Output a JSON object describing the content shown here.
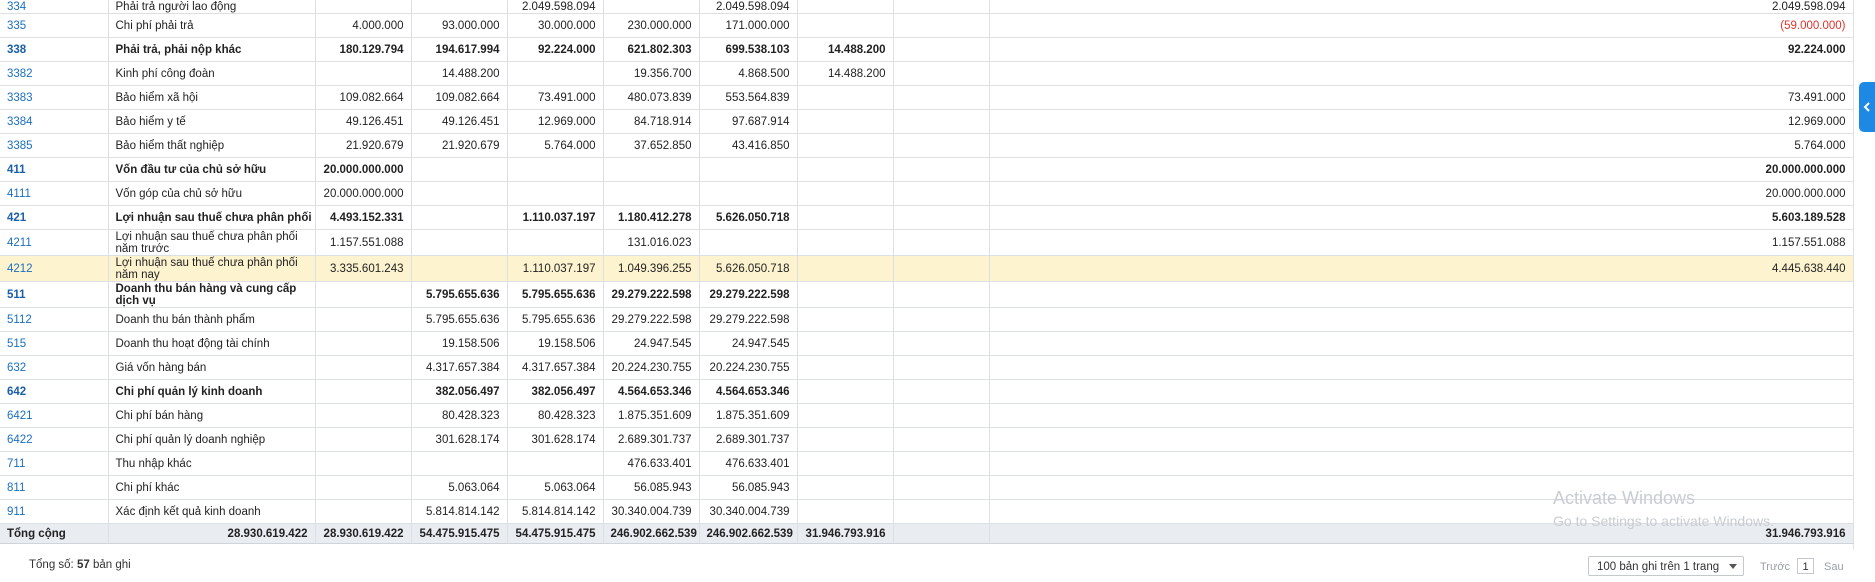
{
  "table": {
    "rows": [
      {
        "acct": "334",
        "name": "Phải trả người lao động",
        "c1": "",
        "c2": "",
        "c3": "2.049.598.094",
        "c4": "",
        "c5": "2.049.598.094",
        "c6": "",
        "c7": "",
        "c8": "2.049.598.094",
        "bold": false
      },
      {
        "acct": "335",
        "name": "Chi phí phải trả",
        "c1": "4.000.000",
        "c2": "93.000.000",
        "c3": "30.000.000",
        "c4": "230.000.000",
        "c5": "171.000.000",
        "c6": "",
        "c7": "",
        "c8": "(59.000.000)",
        "bold": false,
        "neg": true
      },
      {
        "acct": "338",
        "name": "Phải trả, phải nộp khác",
        "c1": "180.129.794",
        "c2": "194.617.994",
        "c3": "92.224.000",
        "c4": "621.802.303",
        "c5": "699.538.103",
        "c6": "14.488.200",
        "c7": "",
        "c8": "92.224.000",
        "bold": true
      },
      {
        "acct": "3382",
        "name": "Kinh phí công đoàn",
        "c1": "",
        "c2": "14.488.200",
        "c3": "",
        "c4": "19.356.700",
        "c5": "4.868.500",
        "c6": "14.488.200",
        "c7": "",
        "c8": "",
        "bold": false
      },
      {
        "acct": "3383",
        "name": "Bảo hiểm xã hội",
        "c1": "109.082.664",
        "c2": "109.082.664",
        "c3": "73.491.000",
        "c4": "480.073.839",
        "c5": "553.564.839",
        "c6": "",
        "c7": "",
        "c8": "73.491.000",
        "bold": false
      },
      {
        "acct": "3384",
        "name": "Bảo hiểm y tế",
        "c1": "49.126.451",
        "c2": "49.126.451",
        "c3": "12.969.000",
        "c4": "84.718.914",
        "c5": "97.687.914",
        "c6": "",
        "c7": "",
        "c8": "12.969.000",
        "bold": false
      },
      {
        "acct": "3385",
        "name": "Bảo hiểm thất nghiệp",
        "c1": "21.920.679",
        "c2": "21.920.679",
        "c3": "5.764.000",
        "c4": "37.652.850",
        "c5": "43.416.850",
        "c6": "",
        "c7": "",
        "c8": "5.764.000",
        "bold": false
      },
      {
        "acct": "411",
        "name": "Vốn đầu tư của chủ sở hữu",
        "c1": "20.000.000.000",
        "c2": "",
        "c3": "",
        "c4": "",
        "c5": "",
        "c6": "",
        "c7": "",
        "c8": "20.000.000.000",
        "bold": true
      },
      {
        "acct": "4111",
        "name": "Vốn góp của chủ sở hữu",
        "c1": "20.000.000.000",
        "c2": "",
        "c3": "",
        "c4": "",
        "c5": "",
        "c6": "",
        "c7": "",
        "c8": "20.000.000.000",
        "bold": false
      },
      {
        "acct": "421",
        "name": "Lợi nhuận sau thuế chưa phân phối",
        "c1": "4.493.152.331",
        "c2": "",
        "c3": "1.110.037.197",
        "c4": "1.180.412.278",
        "c5": "5.626.050.718",
        "c6": "",
        "c7": "",
        "c8": "5.603.189.528",
        "bold": true
      },
      {
        "acct": "4211",
        "name": "Lợi nhuận sau thuế chưa phân phối năm trước",
        "c1": "1.157.551.088",
        "c2": "",
        "c3": "",
        "c4": "131.016.023",
        "c5": "",
        "c6": "",
        "c7": "",
        "c8": "1.157.551.088",
        "bold": false,
        "tall": true
      },
      {
        "acct": "4212",
        "name": "Lợi nhuận sau thuế chưa phân phối năm nay",
        "c1": "3.335.601.243",
        "c2": "",
        "c3": "1.110.037.197",
        "c4": "1.049.396.255",
        "c5": "5.626.050.718",
        "c6": "",
        "c7": "",
        "c8": "4.445.638.440",
        "bold": false,
        "tall": true,
        "selected": true
      },
      {
        "acct": "511",
        "name": "Doanh thu bán hàng và cung cấp dịch vụ",
        "c1": "",
        "c2": "5.795.655.636",
        "c3": "5.795.655.636",
        "c4": "29.279.222.598",
        "c5": "29.279.222.598",
        "c6": "",
        "c7": "",
        "c8": "",
        "bold": true,
        "tall": true
      },
      {
        "acct": "5112",
        "name": "Doanh thu bán thành phẩm",
        "c1": "",
        "c2": "5.795.655.636",
        "c3": "5.795.655.636",
        "c4": "29.279.222.598",
        "c5": "29.279.222.598",
        "c6": "",
        "c7": "",
        "c8": "",
        "bold": false
      },
      {
        "acct": "515",
        "name": "Doanh thu hoạt động tài chính",
        "c1": "",
        "c2": "19.158.506",
        "c3": "19.158.506",
        "c4": "24.947.545",
        "c5": "24.947.545",
        "c6": "",
        "c7": "",
        "c8": "",
        "bold": false
      },
      {
        "acct": "632",
        "name": "Giá vốn hàng bán",
        "c1": "",
        "c2": "4.317.657.384",
        "c3": "4.317.657.384",
        "c4": "20.224.230.755",
        "c5": "20.224.230.755",
        "c6": "",
        "c7": "",
        "c8": "",
        "bold": false
      },
      {
        "acct": "642",
        "name": "Chi phí quản lý kinh doanh",
        "c1": "",
        "c2": "382.056.497",
        "c3": "382.056.497",
        "c4": "4.564.653.346",
        "c5": "4.564.653.346",
        "c6": "",
        "c7": "",
        "c8": "",
        "bold": true
      },
      {
        "acct": "6421",
        "name": "Chi phí bán hàng",
        "c1": "",
        "c2": "80.428.323",
        "c3": "80.428.323",
        "c4": "1.875.351.609",
        "c5": "1.875.351.609",
        "c6": "",
        "c7": "",
        "c8": "",
        "bold": false
      },
      {
        "acct": "6422",
        "name": "Chi phí quản lý doanh nghiệp",
        "c1": "",
        "c2": "301.628.174",
        "c3": "301.628.174",
        "c4": "2.689.301.737",
        "c5": "2.689.301.737",
        "c6": "",
        "c7": "",
        "c8": "",
        "bold": false
      },
      {
        "acct": "711",
        "name": "Thu nhập khác",
        "c1": "",
        "c2": "",
        "c3": "",
        "c4": "476.633.401",
        "c5": "476.633.401",
        "c6": "",
        "c7": "",
        "c8": "",
        "bold": false
      },
      {
        "acct": "811",
        "name": "Chi phí khác",
        "c1": "",
        "c2": "5.063.064",
        "c3": "5.063.064",
        "c4": "56.085.943",
        "c5": "56.085.943",
        "c6": "",
        "c7": "",
        "c8": "",
        "bold": false
      },
      {
        "acct": "911",
        "name": "Xác định kết quả kinh doanh",
        "c1": "",
        "c2": "5.814.814.142",
        "c3": "5.814.814.142",
        "c4": "30.340.004.739",
        "c5": "30.340.004.739",
        "c6": "",
        "c7": "",
        "c8": "",
        "bold": false
      }
    ],
    "total": {
      "label": "Tổng cộng",
      "c0": "28.930.619.422",
      "c1": "28.930.619.422",
      "c2": "54.475.915.475",
      "c3": "54.475.915.475",
      "c4": "246.902.662.539",
      "c5": "246.902.662.539",
      "c6": "31.946.793.916",
      "c7": "",
      "c8": "31.946.793.916"
    }
  },
  "footer": {
    "total_prefix": "Tổng số: ",
    "total_count": "57",
    "total_suffix": " bản ghi",
    "page_size_option": "100 bản ghi trên 1 trang",
    "prev_label": "Trước",
    "page_number": "1",
    "next_label": "Sau"
  },
  "watermark": {
    "line1": "Activate Windows",
    "line2": "Go to Settings to activate Windows."
  },
  "colors": {
    "link": "#1a6fbf",
    "negative": "#e0322b",
    "selected_row": "#fdf3cf",
    "side_tab": "#1e88e5"
  },
  "icons": {
    "side_tab": "chevron-left-icon",
    "select": "chevron-down-icon"
  }
}
